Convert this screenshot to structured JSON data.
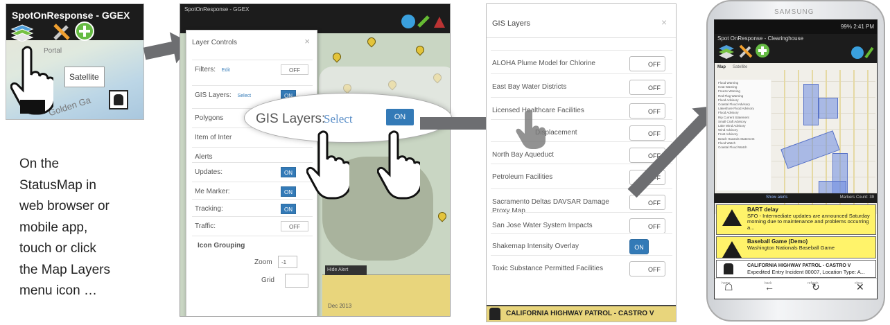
{
  "panel1": {
    "title": "SpotOnResponse - GGEX",
    "satellite_label": "Satellite",
    "map_label_top": "Portal",
    "map_label_bottom": "Golden Ga"
  },
  "caption_lines": [
    "On the",
    "StatusMap in",
    "web browser or",
    "mobile app,",
    "touch or click",
    "the Map Layers",
    "menu icon …"
  ],
  "panel2": {
    "title": "SpotOnResponse - GGEX",
    "modal_title": "Layer Controls",
    "close": "×",
    "rows": [
      {
        "label": "Filters:",
        "link": "Edit",
        "state": "OFF"
      },
      {
        "label": "GIS Layers:",
        "link": "Select",
        "state": "ON"
      },
      {
        "label": "Polygons",
        "link": "",
        "state": ""
      },
      {
        "label": "Item of Inter",
        "link": "",
        "state": ""
      },
      {
        "label": "Alerts",
        "link": "",
        "state": ""
      },
      {
        "label": "Updates:",
        "link": "",
        "state": "ON"
      },
      {
        "label": "Me Marker:",
        "link": "",
        "state": "ON"
      },
      {
        "label": "Tracking:",
        "link": "",
        "state": "ON"
      },
      {
        "label": "Traffic:",
        "link": "",
        "state": "OFF"
      }
    ],
    "icon_grouping": "Icon Grouping",
    "zoom_label": "Zoom",
    "zoom_value": "-1",
    "grid_label": "Grid",
    "bottom_bar": "Hide Alert",
    "bottom_text": "Dec 2013"
  },
  "zoom_callout": {
    "label": "GIS Layers:",
    "link": "Select",
    "toggle": "ON"
  },
  "panel3": {
    "title": "GIS Layers",
    "close": "×",
    "layers": [
      {
        "name": "ALOHA Plume Model for Chlorine",
        "state": "OFF"
      },
      {
        "name": "East Bay Water Districts",
        "state": "OFF"
      },
      {
        "name": "Licensed Healthcare Facilities",
        "state": "OFF"
      },
      {
        "name": "Displacement",
        "state": "OFF"
      },
      {
        "name": "North Bay Aqueduct",
        "state": "OFF"
      },
      {
        "name": "Petroleum Facilities",
        "state": "OFF"
      },
      {
        "name": "Sacramento Deltas DAVSAR Damage Proxy Map",
        "state": "OFF"
      },
      {
        "name": "San Jose Water System Impacts",
        "state": "OFF"
      },
      {
        "name": "Shakemap Intensity Overlay",
        "state": "ON"
      },
      {
        "name": "Toxic Substance Permitted Facilities",
        "state": "OFF"
      }
    ],
    "footer": "CALIFORNIA HIGHWAY PATROL - CASTRO V"
  },
  "phone": {
    "brand": "SAMSUNG",
    "status": "99% 2:41 PM",
    "app_title": "Spot OnResponse - Clearinghouse",
    "tab_map": "Map",
    "tab_satellite": "Satellite",
    "legend": [
      "Flood Warning",
      "Heat Warning",
      "Freeze Warning",
      "Red Flag Warning",
      "Flood Advisory",
      "Coastal Flood Advisory",
      "Lakeshore Flood Advisory",
      "Flood Advisory",
      "Rip Current Statement",
      "Small Craft Advisory",
      "Lake Wind Advisory",
      "Wind Advisory",
      "Frost Advisory",
      "Beach Hazards Statement",
      "Flood Watch",
      "Coastal Flood Watch"
    ],
    "bottom_link": "Show alerts",
    "bottom_right": "Markers Count: 39",
    "alerts": [
      {
        "title": "BART delay",
        "text": "SFO - Intermediate updates are announced Saturday morning due to maintenance and problems occurring a..."
      },
      {
        "title": "Baseball Game (Demo)",
        "text": "Washington Nationals Baseball Game"
      },
      {
        "title": "CALIFORNIA HIGHWAY PATROL - CASTRO V",
        "text": "Expedited Entry Incident 80007, Location Type: A..."
      }
    ],
    "nav": [
      "home",
      "back",
      "refresh",
      "close"
    ]
  }
}
